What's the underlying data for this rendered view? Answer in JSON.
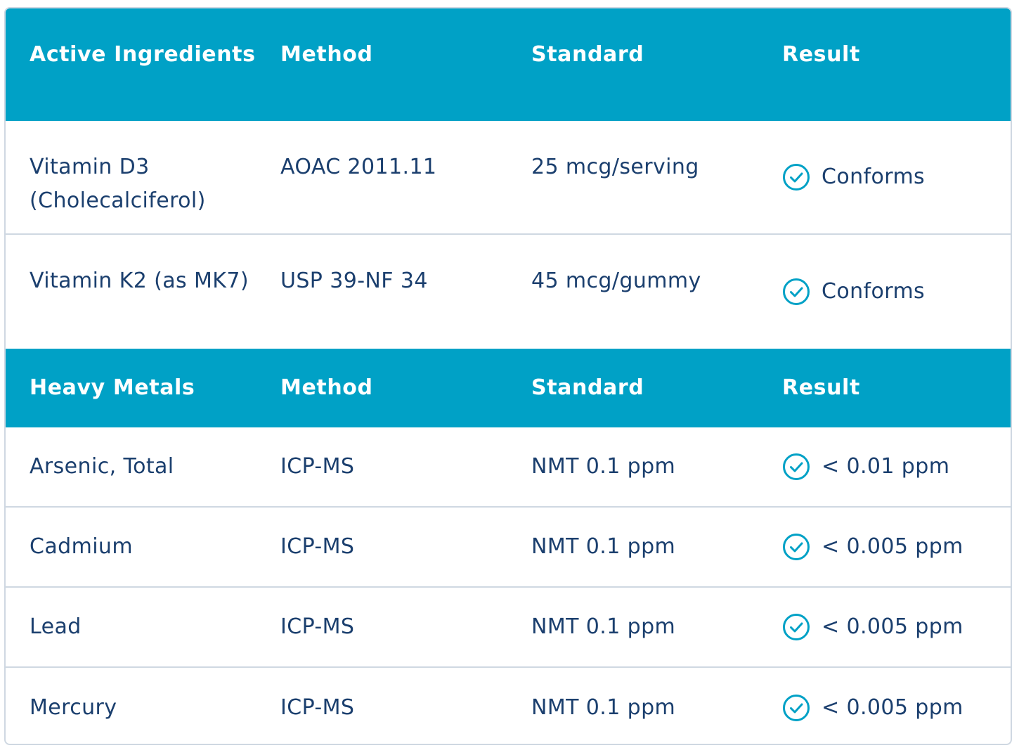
{
  "colors": {
    "header_bg": "#00a1c6",
    "header_text": "#ffffff",
    "body_text": "#1b3f6e",
    "border": "#cfd8e2",
    "check_icon": "#00a1c6"
  },
  "active_ingredients": {
    "headers": [
      "Active Ingredients",
      "Method",
      "Standard",
      "Result"
    ],
    "rows": [
      {
        "name": "Vitamin D3 (Cholecalciferol)",
        "method": "AOAC 2011.11",
        "standard": "25 mcg/serving",
        "result": "Conforms",
        "icon": "check-circle-icon"
      },
      {
        "name": "Vitamin K2 (as MK7)",
        "method": "USP 39-NF 34",
        "standard": "45 mcg/gummy",
        "result": "Conforms",
        "icon": "check-circle-icon"
      }
    ]
  },
  "heavy_metals": {
    "headers": [
      "Heavy Metals",
      "Method",
      "Standard",
      "Result"
    ],
    "rows": [
      {
        "name": "Arsenic, Total",
        "method": "ICP-MS",
        "standard": "NMT 0.1 ppm",
        "result": "< 0.01 ppm",
        "icon": "check-circle-icon"
      },
      {
        "name": "Cadmium",
        "method": "ICP-MS",
        "standard": "NMT 0.1 ppm",
        "result": "< 0.005 ppm",
        "icon": "check-circle-icon"
      },
      {
        "name": "Lead",
        "method": "ICP-MS",
        "standard": "NMT 0.1 ppm",
        "result": "< 0.005 ppm",
        "icon": "check-circle-icon"
      },
      {
        "name": "Mercury",
        "method": "ICP-MS",
        "standard": "NMT 0.1 ppm",
        "result": "< 0.005 ppm",
        "icon": "check-circle-icon"
      }
    ]
  }
}
